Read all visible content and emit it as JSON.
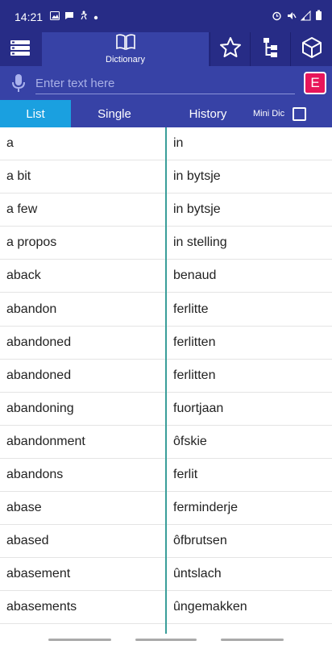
{
  "status": {
    "time": "14:21",
    "left_icons": [
      "gallery-icon",
      "message-icon",
      "accessibility-icon",
      "dot-icon"
    ],
    "right_icons": [
      "alarm-icon",
      "mute-icon",
      "signal-icon",
      "battery-icon"
    ]
  },
  "toolbar": {
    "menu_icon": "menu-icon",
    "dictionary_label": "Dictionary",
    "dictionary_icon": "book-icon",
    "favorites_icon": "star-icon",
    "tree_icon": "tree-icon",
    "cube_icon": "cube-icon"
  },
  "search": {
    "placeholder": "Enter text here",
    "value": "",
    "lang_label": "E"
  },
  "tabs": [
    {
      "label": "List"
    },
    {
      "label": "Single"
    },
    {
      "label": "History"
    }
  ],
  "mini_dic": {
    "label": "Mini Dic",
    "checked": false
  },
  "colors": {
    "primary": "#272c86",
    "secondary": "#3742a6",
    "tab_active": "#1aa0e0",
    "lang_button": "#e8155a",
    "divider": "#3a9e9a"
  },
  "entries": [
    {
      "src": "a",
      "tgt": "in"
    },
    {
      "src": "a bit",
      "tgt": "in bytsje"
    },
    {
      "src": "a few",
      "tgt": "in bytsje"
    },
    {
      "src": "a propos",
      "tgt": "in stelling"
    },
    {
      "src": "aback",
      "tgt": "benaud"
    },
    {
      "src": "abandon",
      "tgt": "ferlitte"
    },
    {
      "src": "abandoned",
      "tgt": "ferlitten"
    },
    {
      "src": "abandoned",
      "tgt": "ferlitten"
    },
    {
      "src": "abandoning",
      "tgt": "fuortjaan"
    },
    {
      "src": "abandonment",
      "tgt": "ôfskie"
    },
    {
      "src": "abandons",
      "tgt": "ferlit"
    },
    {
      "src": "abase",
      "tgt": "ferminderje"
    },
    {
      "src": "abased",
      "tgt": "ôfbrutsen"
    },
    {
      "src": "abasement",
      "tgt": "ûntslach"
    },
    {
      "src": "abasements",
      "tgt": "ûngemakken"
    }
  ]
}
